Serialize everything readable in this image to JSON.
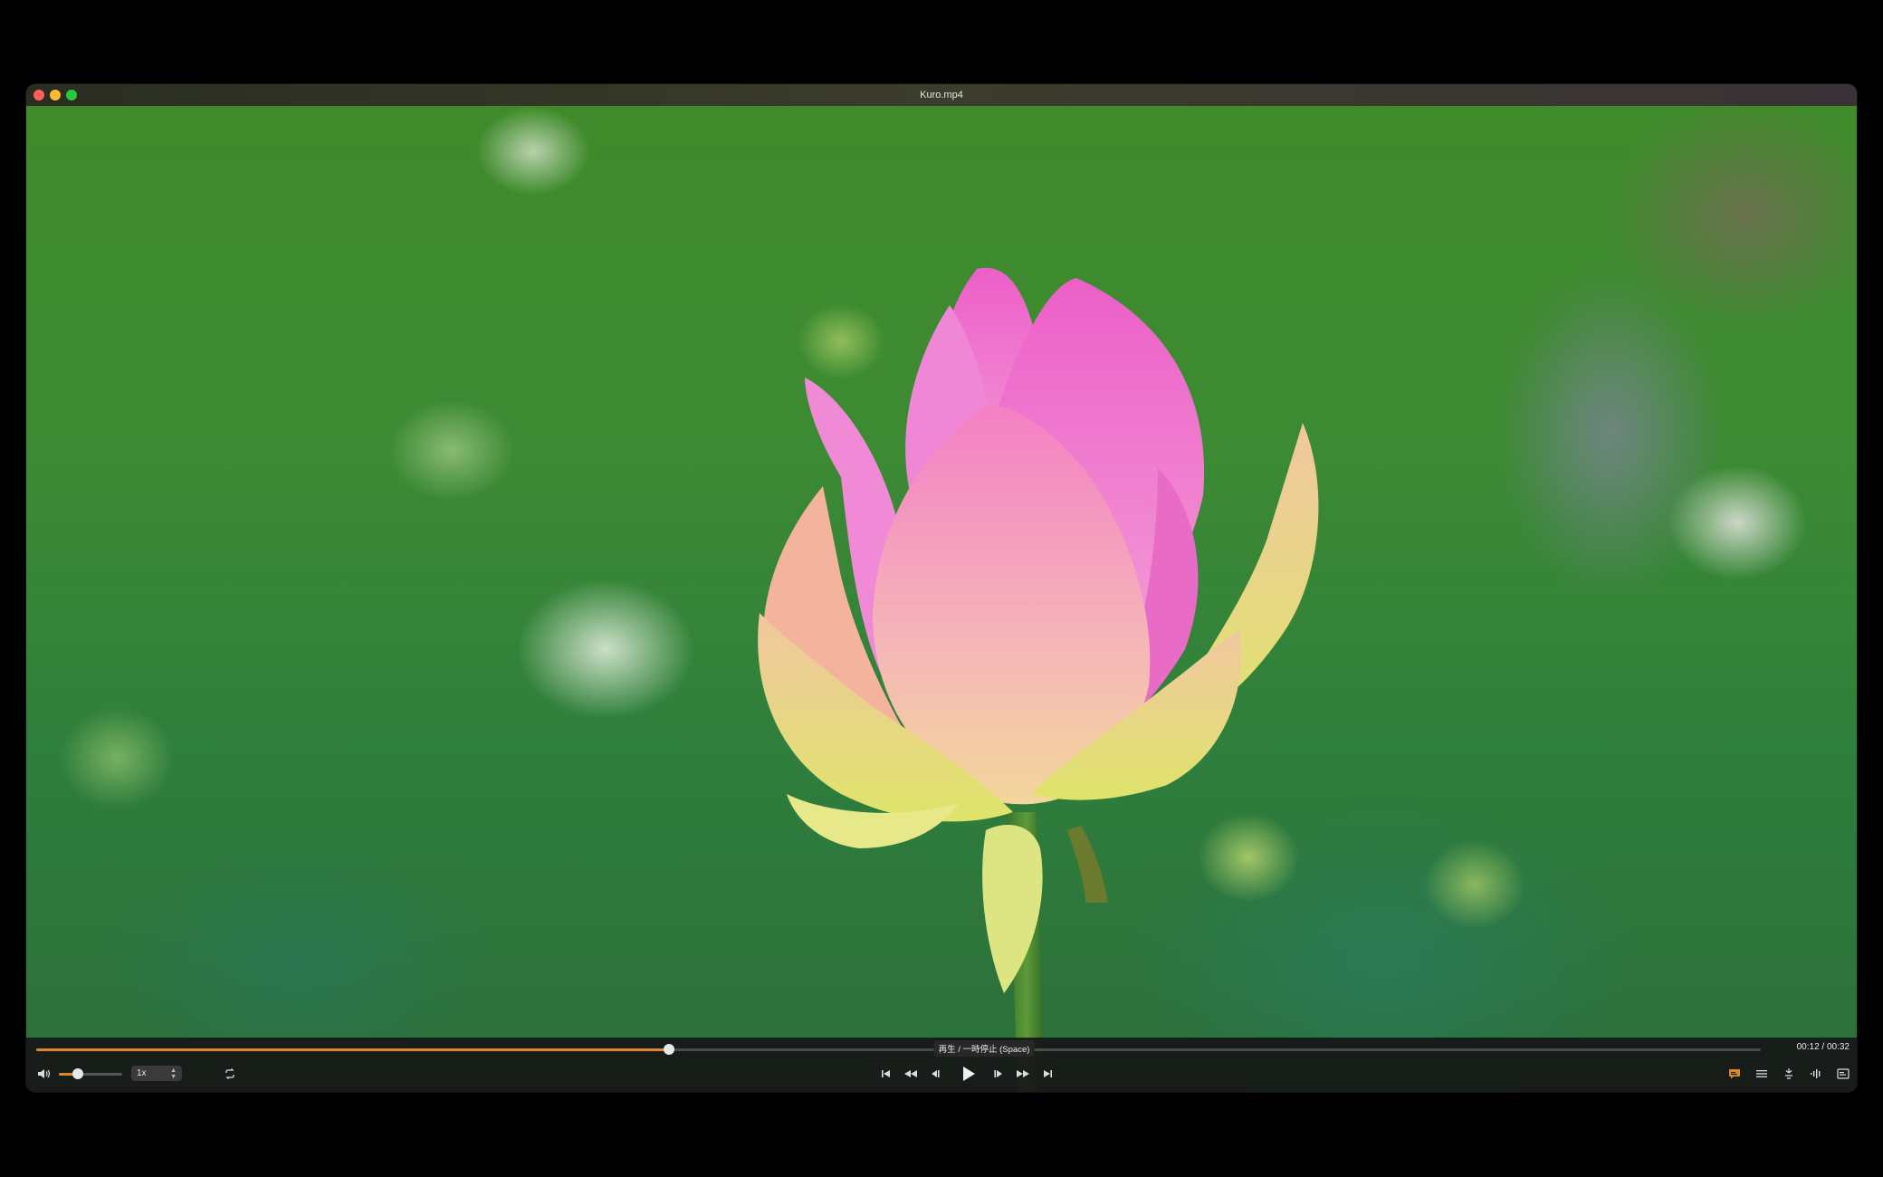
{
  "window": {
    "title": "Kuro.mp4"
  },
  "player": {
    "time_display": "00:12 / 00:32",
    "progress": 0.367,
    "volume": 0.3,
    "speed_label": "1x",
    "tooltip": "再生 / 一時停止 (Space)",
    "accent_color": "#e0862b"
  },
  "controls": {
    "left": [
      "speaker-icon",
      "volume-slider",
      "speed-select",
      "loop-icon"
    ],
    "center": [
      "skip-start-icon",
      "rewind-icon",
      "step-back-icon",
      "play-icon",
      "step-forward-icon",
      "fast-forward-icon",
      "skip-end-icon"
    ],
    "right": [
      "subtitles-icon",
      "chapters-icon",
      "pip-icon",
      "audio-track-icon",
      "info-panel-icon"
    ]
  }
}
